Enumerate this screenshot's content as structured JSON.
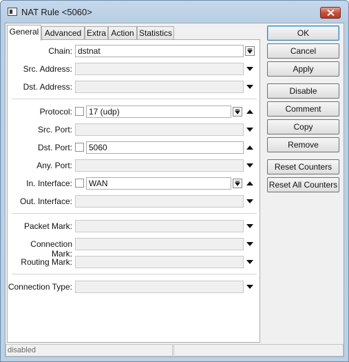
{
  "window": {
    "title": "NAT Rule <5060>",
    "close_icon": "close-x-icon"
  },
  "tabs": [
    {
      "label": "General",
      "active": true
    },
    {
      "label": "Advanced",
      "active": false
    },
    {
      "label": "Extra",
      "active": false
    },
    {
      "label": "Action",
      "active": false
    },
    {
      "label": "Statistics",
      "active": false
    }
  ],
  "fields": {
    "chain": {
      "label": "Chain:",
      "value": "dstnat"
    },
    "src_address": {
      "label": "Src. Address:",
      "value": ""
    },
    "dst_address": {
      "label": "Dst. Address:",
      "value": ""
    },
    "protocol": {
      "label": "Protocol:",
      "value": "17 (udp)",
      "negate": false
    },
    "src_port": {
      "label": "Src. Port:",
      "value": ""
    },
    "dst_port": {
      "label": "Dst. Port:",
      "value": "5060",
      "negate": false
    },
    "any_port": {
      "label": "Any. Port:",
      "value": ""
    },
    "in_interface": {
      "label": "In. Interface:",
      "value": "WAN",
      "negate": false
    },
    "out_interface": {
      "label": "Out. Interface:",
      "value": ""
    },
    "packet_mark": {
      "label": "Packet Mark:",
      "value": ""
    },
    "connection_mark": {
      "label": "Connection Mark:",
      "value": ""
    },
    "routing_mark": {
      "label": "Routing Mark:",
      "value": ""
    },
    "connection_type": {
      "label": "Connection Type:",
      "value": ""
    }
  },
  "buttons": {
    "ok": "OK",
    "cancel": "Cancel",
    "apply": "Apply",
    "disable": "Disable",
    "comment": "Comment",
    "copy": "Copy",
    "remove": "Remove",
    "reset_counters": "Reset Counters",
    "reset_all_counters": "Reset All Counters"
  },
  "status": {
    "left": "disabled",
    "right": ""
  },
  "colors": {
    "title_bar": "#bcd0e6",
    "close_button": "#c7503a",
    "default_button_border": "#3c7fb1"
  }
}
